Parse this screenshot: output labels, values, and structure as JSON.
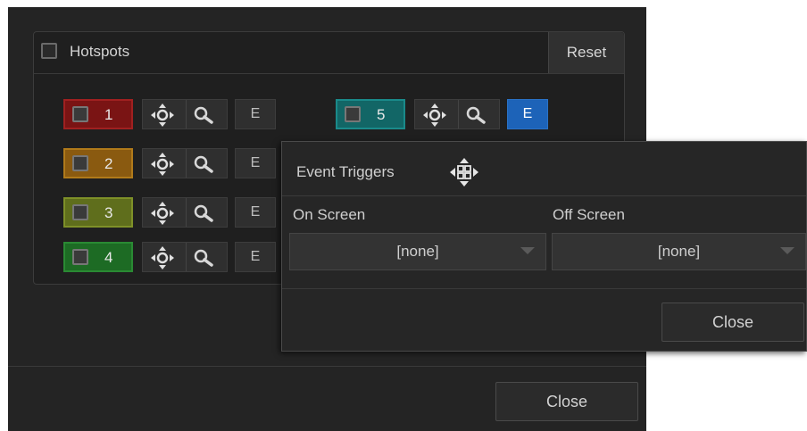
{
  "hotspots": {
    "title": "Hotspots",
    "reset_label": "Reset",
    "items": [
      {
        "number": "1",
        "color": "#7a1414",
        "edit_label": "E"
      },
      {
        "number": "2",
        "color": "#8a5a10",
        "edit_label": "E"
      },
      {
        "number": "3",
        "color": "#5f6e1c",
        "edit_label": "E"
      },
      {
        "number": "4",
        "color": "#1d6b24",
        "edit_label": "E"
      },
      {
        "number": "5",
        "color": "#126666",
        "edit_label": "E"
      }
    ]
  },
  "event_triggers": {
    "title": "Event Triggers",
    "on_screen_label": "On Screen",
    "on_screen_value": "[none]",
    "off_screen_label": "Off Screen",
    "off_screen_value": "[none]",
    "close_label": "Close"
  },
  "footer": {
    "close_label": "Close"
  },
  "colors": {
    "active_edit": "#1d63b8"
  }
}
